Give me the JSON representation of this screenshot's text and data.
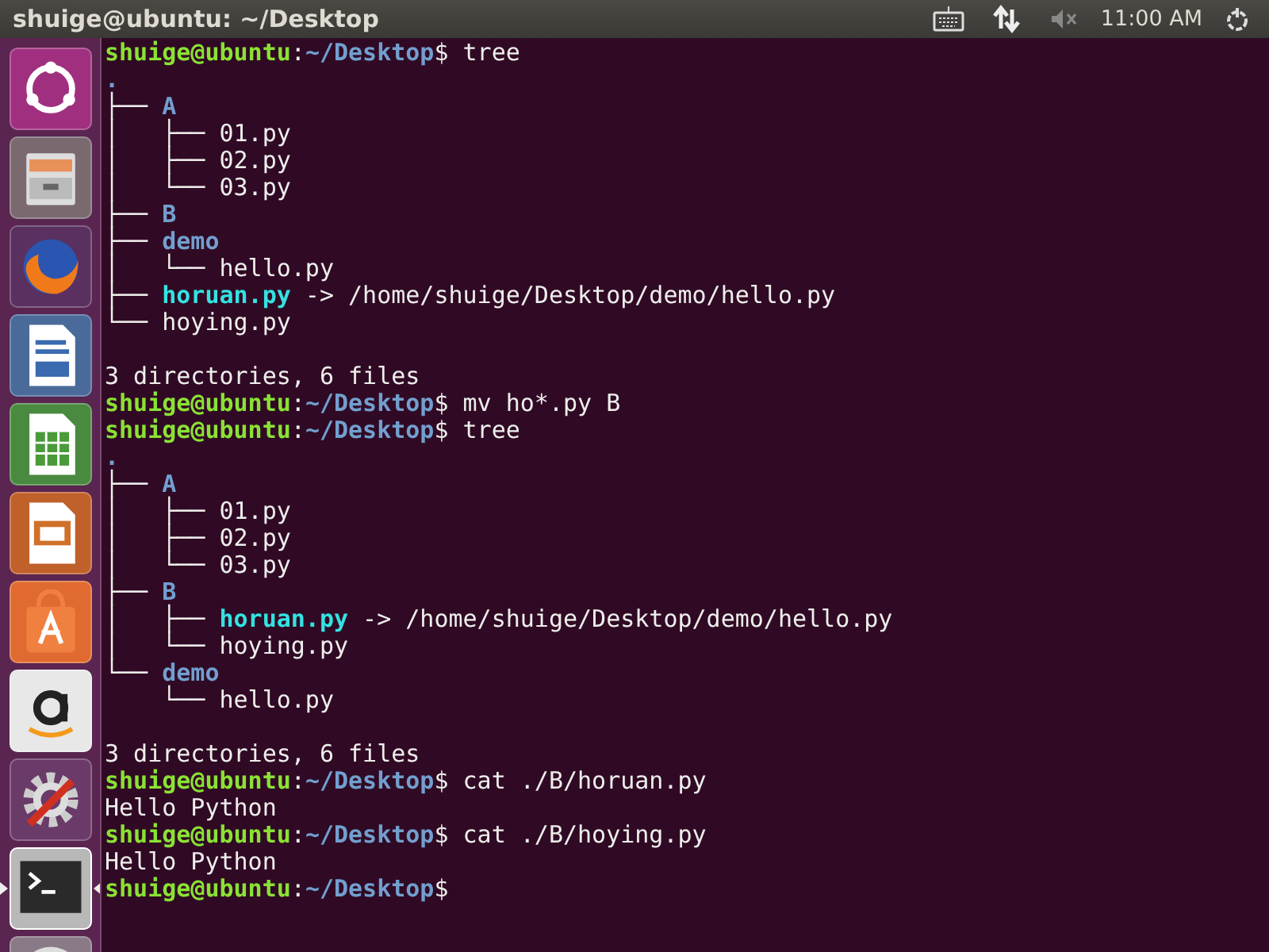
{
  "window": {
    "title": "shuige@ubuntu: ~/Desktop"
  },
  "panel": {
    "indicators": [
      {
        "kind": "keyboard"
      },
      {
        "kind": "network"
      },
      {
        "kind": "sound-muted"
      }
    ],
    "clock": "11:00 AM",
    "power": {
      "kind": "power"
    }
  },
  "launcher": {
    "items": [
      {
        "kind": "dash",
        "selected": false
      },
      {
        "kind": "files",
        "selected": false
      },
      {
        "kind": "browser",
        "selected": false
      },
      {
        "kind": "writer",
        "selected": false
      },
      {
        "kind": "calc",
        "selected": false
      },
      {
        "kind": "impress",
        "selected": false
      },
      {
        "kind": "software",
        "selected": false
      },
      {
        "kind": "amazon",
        "selected": false
      },
      {
        "kind": "settings",
        "selected": false
      },
      {
        "kind": "terminal",
        "selected": true
      },
      {
        "kind": "disc",
        "selected": false
      }
    ]
  },
  "terminal": {
    "lines": [
      {
        "kind": "text",
        "segments": [
          {
            "kind": "user",
            "text": "shuige@ubuntu"
          },
          {
            "kind": "plain",
            "text": ":"
          },
          {
            "kind": "path",
            "text": "~/Desktop"
          },
          {
            "kind": "plain",
            "text": "$ tree"
          }
        ]
      },
      {
        "kind": "text",
        "segments": [
          {
            "kind": "dir",
            "text": "."
          }
        ]
      },
      {
        "kind": "text",
        "segments": [
          {
            "kind": "plain",
            "text": "├── "
          },
          {
            "kind": "dir",
            "text": "A"
          }
        ]
      },
      {
        "kind": "text",
        "segments": [
          {
            "kind": "plain",
            "text": "│   ├── 01.py"
          }
        ]
      },
      {
        "kind": "text",
        "segments": [
          {
            "kind": "plain",
            "text": "│   ├── 02.py"
          }
        ]
      },
      {
        "kind": "text",
        "segments": [
          {
            "kind": "plain",
            "text": "│   └── 03.py"
          }
        ]
      },
      {
        "kind": "text",
        "segments": [
          {
            "kind": "plain",
            "text": "├── "
          },
          {
            "kind": "dir",
            "text": "B"
          }
        ]
      },
      {
        "kind": "text",
        "segments": [
          {
            "kind": "plain",
            "text": "├── "
          },
          {
            "kind": "dir",
            "text": "demo"
          }
        ]
      },
      {
        "kind": "text",
        "segments": [
          {
            "kind": "plain",
            "text": "│   └── hello.py"
          }
        ]
      },
      {
        "kind": "text",
        "segments": [
          {
            "kind": "plain",
            "text": "├── "
          },
          {
            "kind": "link",
            "text": "horuan.py"
          },
          {
            "kind": "plain",
            "text": " -> /home/shuige/Desktop/demo/hello.py"
          }
        ]
      },
      {
        "kind": "text",
        "segments": [
          {
            "kind": "plain",
            "text": "└── hoying.py"
          }
        ]
      },
      {
        "kind": "blank"
      },
      {
        "kind": "text",
        "segments": [
          {
            "kind": "plain",
            "text": "3 directories, 6 files"
          }
        ]
      },
      {
        "kind": "text",
        "segments": [
          {
            "kind": "user",
            "text": "shuige@ubuntu"
          },
          {
            "kind": "plain",
            "text": ":"
          },
          {
            "kind": "path",
            "text": "~/Desktop"
          },
          {
            "kind": "plain",
            "text": "$ mv ho*.py B"
          }
        ]
      },
      {
        "kind": "text",
        "segments": [
          {
            "kind": "user",
            "text": "shuige@ubuntu"
          },
          {
            "kind": "plain",
            "text": ":"
          },
          {
            "kind": "path",
            "text": "~/Desktop"
          },
          {
            "kind": "plain",
            "text": "$ tree"
          }
        ]
      },
      {
        "kind": "text",
        "segments": [
          {
            "kind": "dir",
            "text": "."
          }
        ]
      },
      {
        "kind": "text",
        "segments": [
          {
            "kind": "plain",
            "text": "├── "
          },
          {
            "kind": "dir",
            "text": "A"
          }
        ]
      },
      {
        "kind": "text",
        "segments": [
          {
            "kind": "plain",
            "text": "│   ├── 01.py"
          }
        ]
      },
      {
        "kind": "text",
        "segments": [
          {
            "kind": "plain",
            "text": "│   ├── 02.py"
          }
        ]
      },
      {
        "kind": "text",
        "segments": [
          {
            "kind": "plain",
            "text": "│   └── 03.py"
          }
        ]
      },
      {
        "kind": "text",
        "segments": [
          {
            "kind": "plain",
            "text": "├── "
          },
          {
            "kind": "dir",
            "text": "B"
          }
        ]
      },
      {
        "kind": "text",
        "segments": [
          {
            "kind": "plain",
            "text": "│   ├── "
          },
          {
            "kind": "link",
            "text": "horuan.py"
          },
          {
            "kind": "plain",
            "text": " -> /home/shuige/Desktop/demo/hello.py"
          }
        ]
      },
      {
        "kind": "text",
        "segments": [
          {
            "kind": "plain",
            "text": "│   └── hoying.py"
          }
        ]
      },
      {
        "kind": "text",
        "segments": [
          {
            "kind": "plain",
            "text": "└── "
          },
          {
            "kind": "dir",
            "text": "demo"
          }
        ]
      },
      {
        "kind": "text",
        "segments": [
          {
            "kind": "plain",
            "text": "    └── hello.py"
          }
        ]
      },
      {
        "kind": "blank"
      },
      {
        "kind": "text",
        "segments": [
          {
            "kind": "plain",
            "text": "3 directories, 6 files"
          }
        ]
      },
      {
        "kind": "text",
        "segments": [
          {
            "kind": "user",
            "text": "shuige@ubuntu"
          },
          {
            "kind": "plain",
            "text": ":"
          },
          {
            "kind": "path",
            "text": "~/Desktop"
          },
          {
            "kind": "plain",
            "text": "$ cat ./B/horuan.py"
          }
        ]
      },
      {
        "kind": "text",
        "segments": [
          {
            "kind": "plain",
            "text": "Hello Python"
          }
        ]
      },
      {
        "kind": "text",
        "segments": [
          {
            "kind": "user",
            "text": "shuige@ubuntu"
          },
          {
            "kind": "plain",
            "text": ":"
          },
          {
            "kind": "path",
            "text": "~/Desktop"
          },
          {
            "kind": "plain",
            "text": "$ cat ./B/hoying.py"
          }
        ]
      },
      {
        "kind": "text",
        "segments": [
          {
            "kind": "plain",
            "text": "Hello Python"
          }
        ]
      },
      {
        "kind": "text",
        "segments": [
          {
            "kind": "user",
            "text": "shuige@ubuntu"
          },
          {
            "kind": "plain",
            "text": ":"
          },
          {
            "kind": "path",
            "text": "~/Desktop"
          },
          {
            "kind": "plain",
            "text": "$"
          }
        ]
      }
    ]
  }
}
